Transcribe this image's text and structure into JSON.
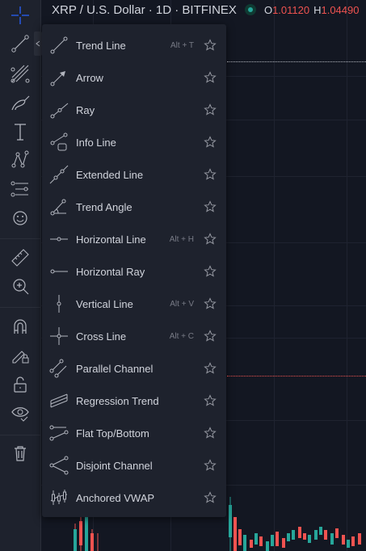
{
  "header": {
    "symbol": "XRP / U.S. Dollar · 1D · BITFINEX",
    "open_label": "O",
    "open_value": "1.01120",
    "high_label": "H",
    "high_value": "1.04490"
  },
  "colors": {
    "background": "#131722",
    "panel": "#1e222d",
    "accent": "#2962ff",
    "up": "#26a69a",
    "down": "#ef5350",
    "text": "#d1d4dc",
    "muted": "#787b86"
  },
  "toolbar": {
    "icons": [
      "crosshair-icon",
      "trend-line-icon",
      "gann-fib-icon",
      "brush-icon",
      "text-icon",
      "pattern-icon",
      "prediction-icon",
      "emoji-icon",
      "ruler-icon",
      "zoom-in-icon",
      "magnet-icon",
      "lock-drawing-icon",
      "unlock-icon",
      "eye-icon",
      "trash-icon"
    ]
  },
  "menu": {
    "items": [
      {
        "label": "Trend Line",
        "hotkey": "Alt + T",
        "icon": "trend-line-icon"
      },
      {
        "label": "Arrow",
        "hotkey": "",
        "icon": "arrow-icon"
      },
      {
        "label": "Ray",
        "hotkey": "",
        "icon": "ray-icon"
      },
      {
        "label": "Info Line",
        "hotkey": "",
        "icon": "info-line-icon"
      },
      {
        "label": "Extended Line",
        "hotkey": "",
        "icon": "extended-line-icon"
      },
      {
        "label": "Trend Angle",
        "hotkey": "",
        "icon": "trend-angle-icon"
      },
      {
        "label": "Horizontal Line",
        "hotkey": "Alt + H",
        "icon": "horizontal-line-icon"
      },
      {
        "label": "Horizontal Ray",
        "hotkey": "",
        "icon": "horizontal-ray-icon"
      },
      {
        "label": "Vertical Line",
        "hotkey": "Alt + V",
        "icon": "vertical-line-icon"
      },
      {
        "label": "Cross Line",
        "hotkey": "Alt + C",
        "icon": "cross-line-icon"
      },
      {
        "label": "Parallel Channel",
        "hotkey": "",
        "icon": "parallel-channel-icon"
      },
      {
        "label": "Regression Trend",
        "hotkey": "",
        "icon": "regression-trend-icon"
      },
      {
        "label": "Flat Top/Bottom",
        "hotkey": "",
        "icon": "flat-top-bottom-icon"
      },
      {
        "label": "Disjoint Channel",
        "hotkey": "",
        "icon": "disjoint-channel-icon"
      },
      {
        "label": "Anchored VWAP",
        "hotkey": "",
        "icon": "anchored-vwap-icon"
      }
    ]
  }
}
